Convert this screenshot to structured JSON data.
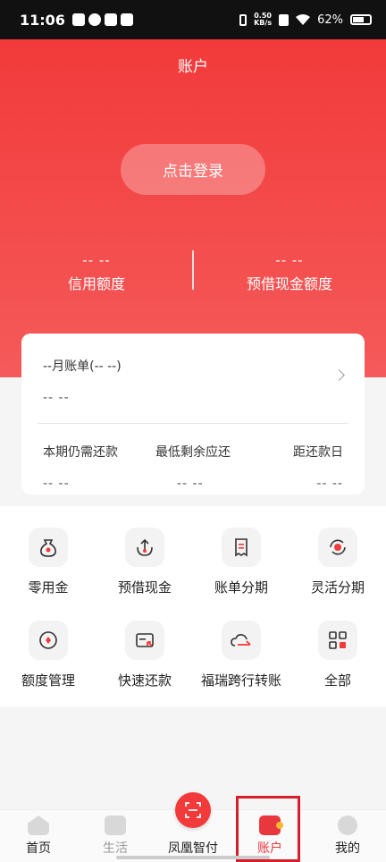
{
  "status": {
    "time": "11:06",
    "speed_value": "0.50",
    "speed_unit": "KB/s",
    "battery": "62%"
  },
  "header": {
    "title": "账户",
    "login_label": "点击登录"
  },
  "quota": {
    "credit_value": "-- --",
    "credit_label": "信用额度",
    "cash_value": "-- --",
    "cash_label": "预借现金额度"
  },
  "bill": {
    "title": "--月账单(-- --)",
    "amount": "-- --",
    "columns": [
      {
        "label": "本期仍需还款",
        "value": "-- --"
      },
      {
        "label": "最低剩余应还",
        "value": "-- --"
      },
      {
        "label": "距还款日",
        "value": "-- --"
      }
    ]
  },
  "services": [
    {
      "label": "零用金",
      "icon": "money-bag-icon"
    },
    {
      "label": "预借现金",
      "icon": "cash-withdraw-icon"
    },
    {
      "label": "账单分期",
      "icon": "bill-receipt-icon"
    },
    {
      "label": "灵活分期",
      "icon": "refresh-yuan-icon"
    },
    {
      "label": "额度管理",
      "icon": "quota-dial-icon"
    },
    {
      "label": "快速还款",
      "icon": "card-repay-icon"
    },
    {
      "label": "福瑞跨行转账",
      "icon": "cloud-transfer-icon"
    },
    {
      "label": "全部",
      "icon": "grid-icon"
    }
  ],
  "tabs": [
    {
      "label": "首页",
      "icon": "home-icon"
    },
    {
      "label": "生活",
      "icon": "shopping-bag-icon"
    },
    {
      "label": "凤凰智付",
      "icon": "scan-icon"
    },
    {
      "label": "账户",
      "icon": "wallet-icon"
    },
    {
      "label": "我的",
      "icon": "profile-icon"
    }
  ],
  "colors": {
    "brand": "#f23a3a",
    "highlight": "#d81e2a"
  }
}
